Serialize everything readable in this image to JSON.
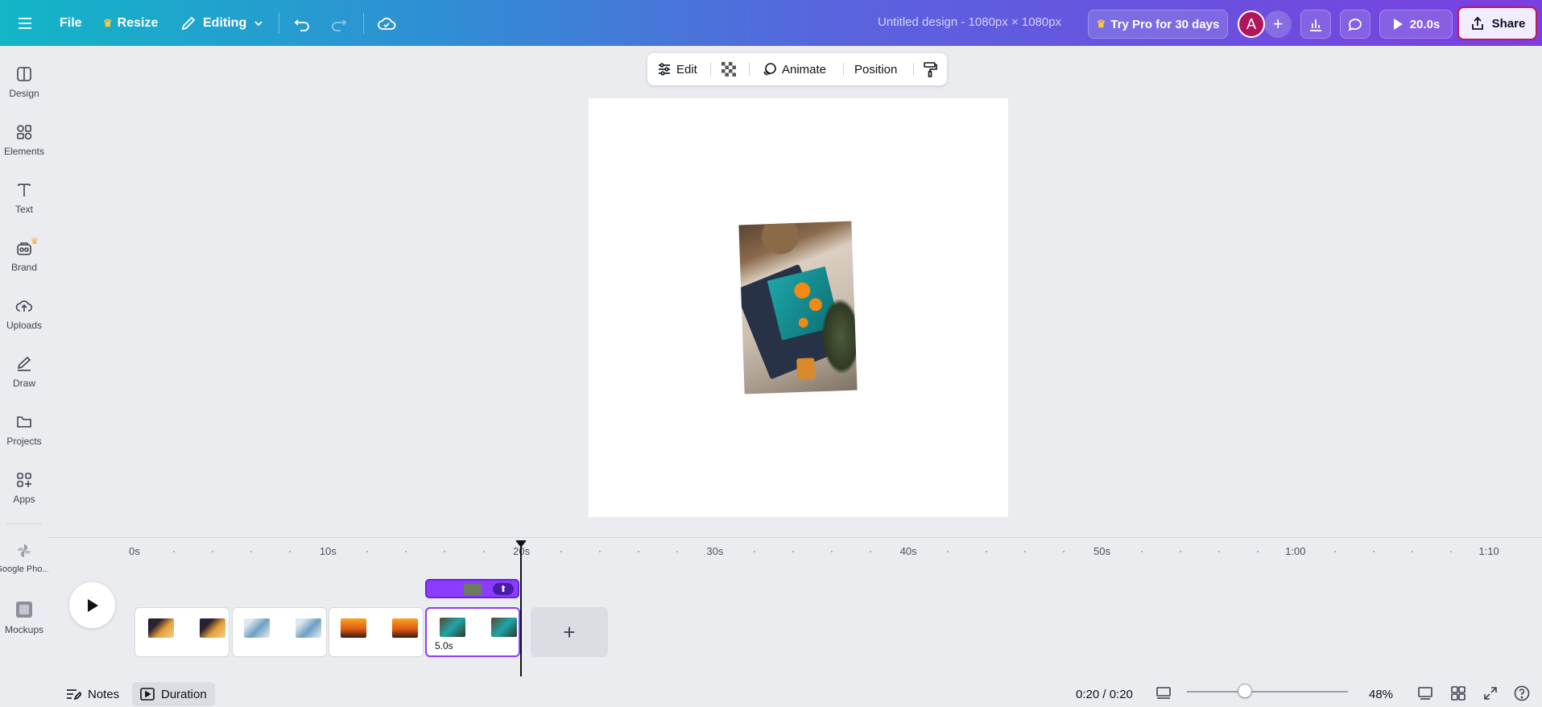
{
  "topbar": {
    "file_label": "File",
    "resize_label": "Resize",
    "editing_label": "Editing",
    "doc_title": "Untitled design - 1080px × 1080px",
    "try_pro_label": "Try Pro for 30 days",
    "avatar_initial": "A",
    "present_label": "20.0s",
    "share_label": "Share",
    "colors": {
      "gradient_start": "#12b6c7",
      "gradient_end": "#7a3fe0",
      "share_border": "#c0175c"
    }
  },
  "sidebar": {
    "items": [
      {
        "label": "Design",
        "icon": "layout-icon"
      },
      {
        "label": "Elements",
        "icon": "shapes-icon"
      },
      {
        "label": "Text",
        "icon": "text-icon"
      },
      {
        "label": "Brand",
        "icon": "brand-icon"
      },
      {
        "label": "Uploads",
        "icon": "cloud-upload-icon"
      },
      {
        "label": "Draw",
        "icon": "pen-icon"
      },
      {
        "label": "Projects",
        "icon": "folder-icon"
      },
      {
        "label": "Apps",
        "icon": "apps-grid-icon"
      },
      {
        "label": "Google Pho...",
        "icon": "google-photos-icon"
      },
      {
        "label": "Mockups",
        "icon": "mockups-icon"
      }
    ]
  },
  "context_toolbar": {
    "edit_label": "Edit",
    "animate_label": "Animate",
    "position_label": "Position"
  },
  "timeline": {
    "ruler_labels": [
      "0s",
      "10s",
      "20s",
      "30s",
      "40s",
      "50s",
      "1:00",
      "1:10"
    ],
    "active_clip_duration": "5.0s",
    "add_label": "+"
  },
  "bottombar": {
    "notes_label": "Notes",
    "duration_label": "Duration",
    "time_readout": "0:20 / 0:20",
    "zoom_level": "48%",
    "zoom_fraction": 0.36
  }
}
